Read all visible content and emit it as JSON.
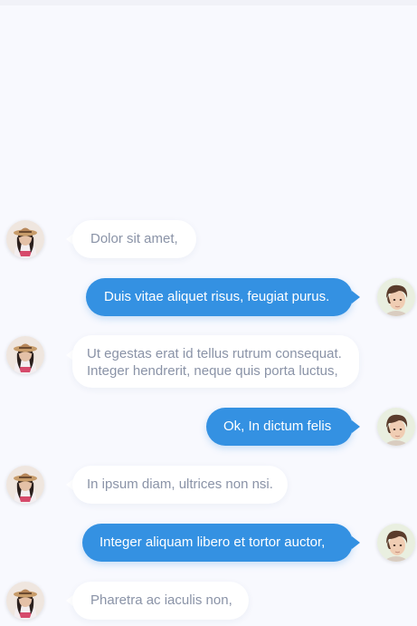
{
  "conversation": {
    "messages": [
      {
        "sender": "contact",
        "avatar": "girl-with-hat-avatar",
        "lines": [
          "Dolor sit amet,"
        ]
      },
      {
        "sender": "me",
        "avatar": "young-man-avatar",
        "lines": [
          "Duis vitae aliquet risus, feugiat purus."
        ]
      },
      {
        "sender": "contact",
        "avatar": "girl-with-hat-avatar",
        "lines": [
          "Ut egestas erat id tellus rutrum consequat.",
          "Integer hendrerit, neque quis porta luctus,"
        ]
      },
      {
        "sender": "me",
        "avatar": "young-man-avatar",
        "lines": [
          "Ok, In dictum felis"
        ]
      },
      {
        "sender": "contact",
        "avatar": "girl-with-hat-avatar",
        "lines": [
          "In ipsum diam, ultrices non nsi."
        ]
      },
      {
        "sender": "me",
        "avatar": "young-man-avatar",
        "lines": [
          "Integer aliquam libero et tortor auctor,"
        ]
      },
      {
        "sender": "contact",
        "avatar": "girl-with-hat-avatar",
        "lines": [
          "Pharetra ac iaculis non,"
        ]
      }
    ]
  },
  "colors": {
    "background": "#f8f9fe",
    "incoming_bubble": "#ffffff",
    "incoming_text": "#8a93a7",
    "outgoing_bubble": "#3491e2",
    "outgoing_text": "#ffffff"
  }
}
